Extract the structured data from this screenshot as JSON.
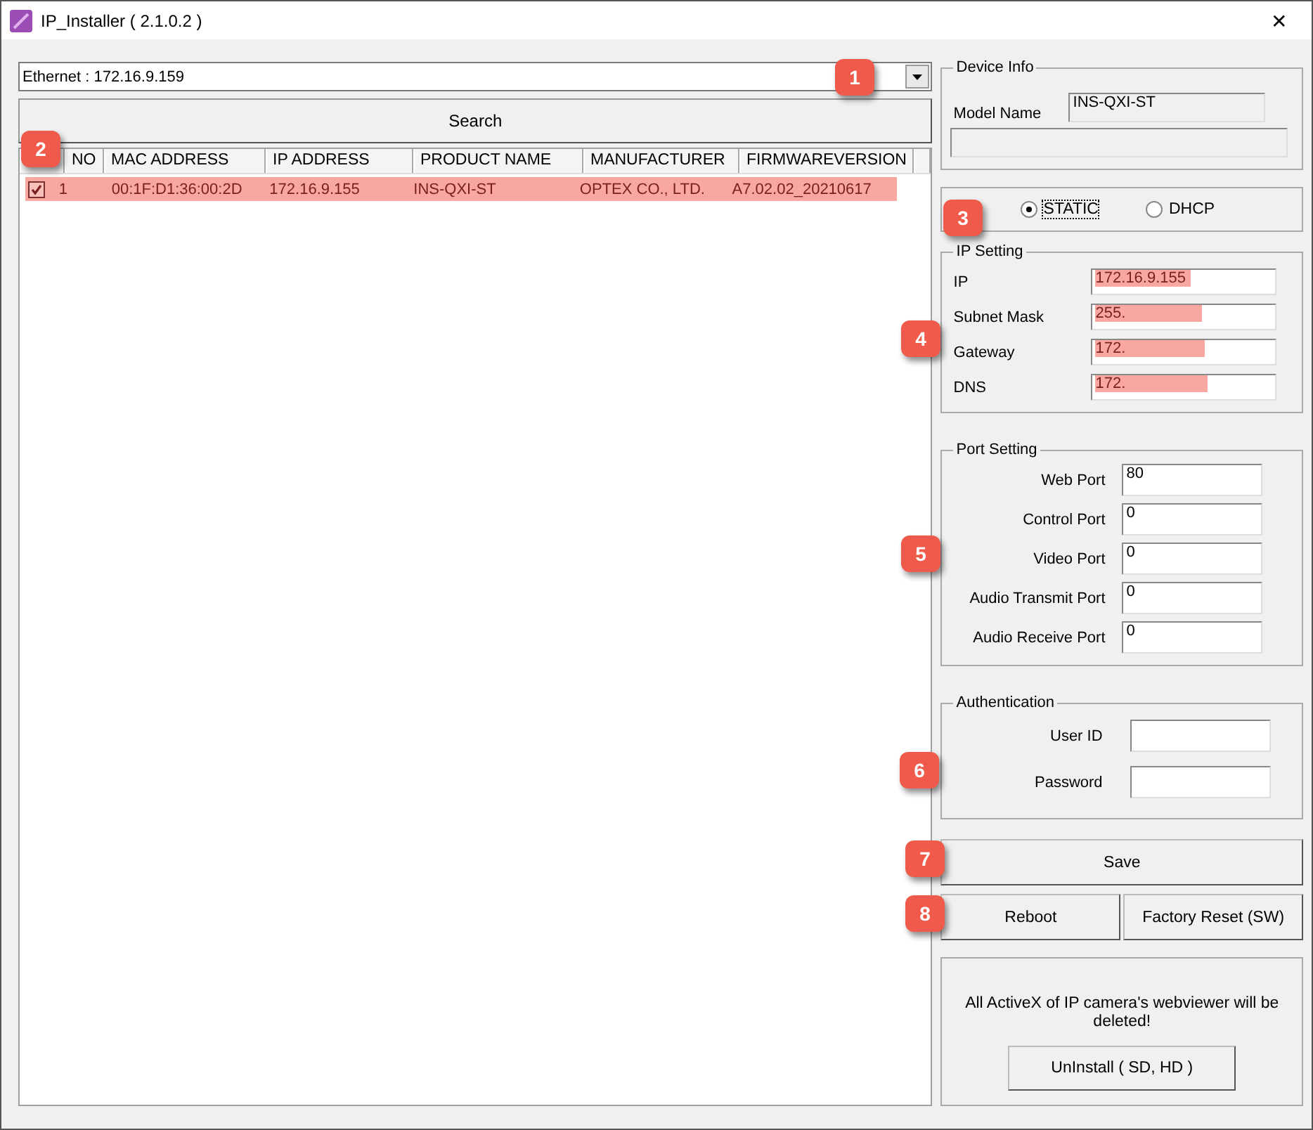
{
  "window": {
    "title": "IP_Installer ( 2.1.0.2 )",
    "close": "✕"
  },
  "adapter": {
    "value": "Ethernet : 172.16.9.159"
  },
  "search_button": "Search",
  "table": {
    "columns": [
      "NO",
      "MAC ADDRESS",
      "IP ADDRESS",
      "PRODUCT NAME",
      "MANUFACTURER",
      "FIRMWAREVERSION"
    ],
    "rows": [
      {
        "checked": true,
        "selected": true,
        "cells": [
          "1",
          "00:1F:D1:36:00:2D",
          "172.16.9.155",
          "INS-QXI-ST",
          "OPTEX CO., LTD.",
          "A7.02.02_20210617"
        ]
      }
    ]
  },
  "device_info": {
    "title": "Device Info",
    "model_label": "Model Name",
    "model_value": "INS-QXI-ST"
  },
  "mode": [
    {
      "label": "STATIC",
      "selected": true
    },
    {
      "label": "DHCP",
      "selected": false
    }
  ],
  "ip_setting": {
    "title": "IP Setting",
    "fields": [
      {
        "label": "IP",
        "value": "172.16.9.155",
        "highlighted": true
      },
      {
        "label": "Subnet Mask",
        "value": "255.",
        "highlighted": true
      },
      {
        "label": "Gateway",
        "value": "172.",
        "highlighted": true
      },
      {
        "label": "DNS",
        "value": "172.",
        "highlighted": true
      }
    ]
  },
  "port_setting": {
    "title": "Port Setting",
    "fields": [
      {
        "label": "Web Port",
        "value": "80"
      },
      {
        "label": "Control Port",
        "value": "0"
      },
      {
        "label": "Video Port",
        "value": "0"
      },
      {
        "label": "Audio Transmit Port",
        "value": "0"
      },
      {
        "label": "Audio Receive Port",
        "value": "0"
      }
    ]
  },
  "authentication": {
    "title": "Authentication",
    "fields": [
      {
        "label": "User ID"
      },
      {
        "label": "Password"
      }
    ]
  },
  "buttons": {
    "save": "Save",
    "reboot": "Reboot",
    "factory_reset": "Factory Reset (SW)"
  },
  "uninstall": {
    "message": "All ActiveX of IP camera's webviewer will be deleted!",
    "button": "UnInstall ( SD, HD )"
  },
  "callouts": [
    "1",
    "2",
    "3",
    "4",
    "5",
    "6",
    "7",
    "8"
  ]
}
